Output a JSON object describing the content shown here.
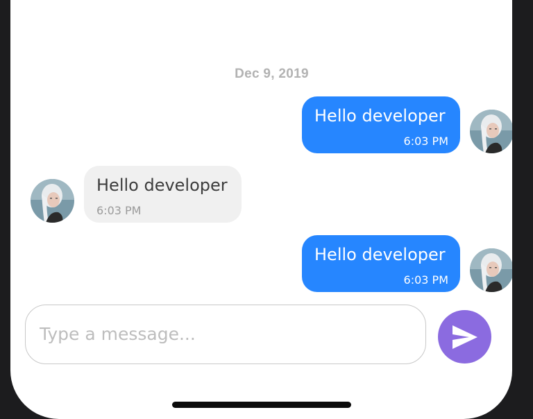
{
  "chat": {
    "date_separator": "Dec 9, 2019",
    "messages": [
      {
        "direction": "outgoing",
        "text": "Hello developer",
        "time": "6:03 PM"
      },
      {
        "direction": "incoming",
        "text": "Hello developer",
        "time": "6:03 PM"
      },
      {
        "direction": "outgoing",
        "text": "Hello developer",
        "time": "6:03 PM"
      }
    ]
  },
  "composer": {
    "placeholder": "Type a message...",
    "value": "",
    "send_icon": "send-icon"
  },
  "colors": {
    "outgoing_bubble": "#2686ff",
    "incoming_bubble": "#f0f0f0",
    "send_button": "#8b6be0"
  }
}
